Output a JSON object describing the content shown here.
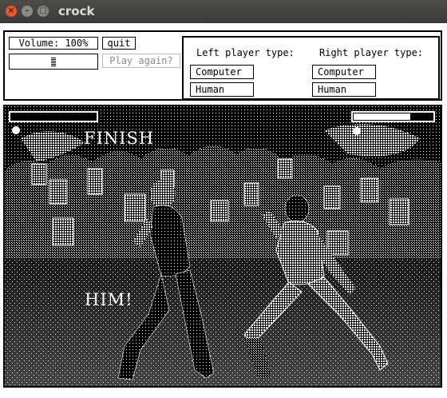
{
  "window": {
    "title": "crock",
    "close_glyph": "×",
    "minimize_glyph": "–",
    "maximize_glyph": "□"
  },
  "controls": {
    "volume_label": "Volume: 100%",
    "quit_label": "quit",
    "volume_level": 0.5,
    "play_again_label": "Play again?"
  },
  "players": {
    "left": {
      "label": "Left player type:",
      "options": [
        "Computer",
        "Human"
      ]
    },
    "right": {
      "label": "Right player type:",
      "options": [
        "Computer",
        "Human"
      ]
    }
  },
  "arena": {
    "left_health": 0.0,
    "right_health": 0.72,
    "announcement_line1": "FINISH",
    "announcement_line2": "HIM!"
  },
  "icons": [
    "close-icon",
    "minimize-icon",
    "maximize-icon"
  ]
}
